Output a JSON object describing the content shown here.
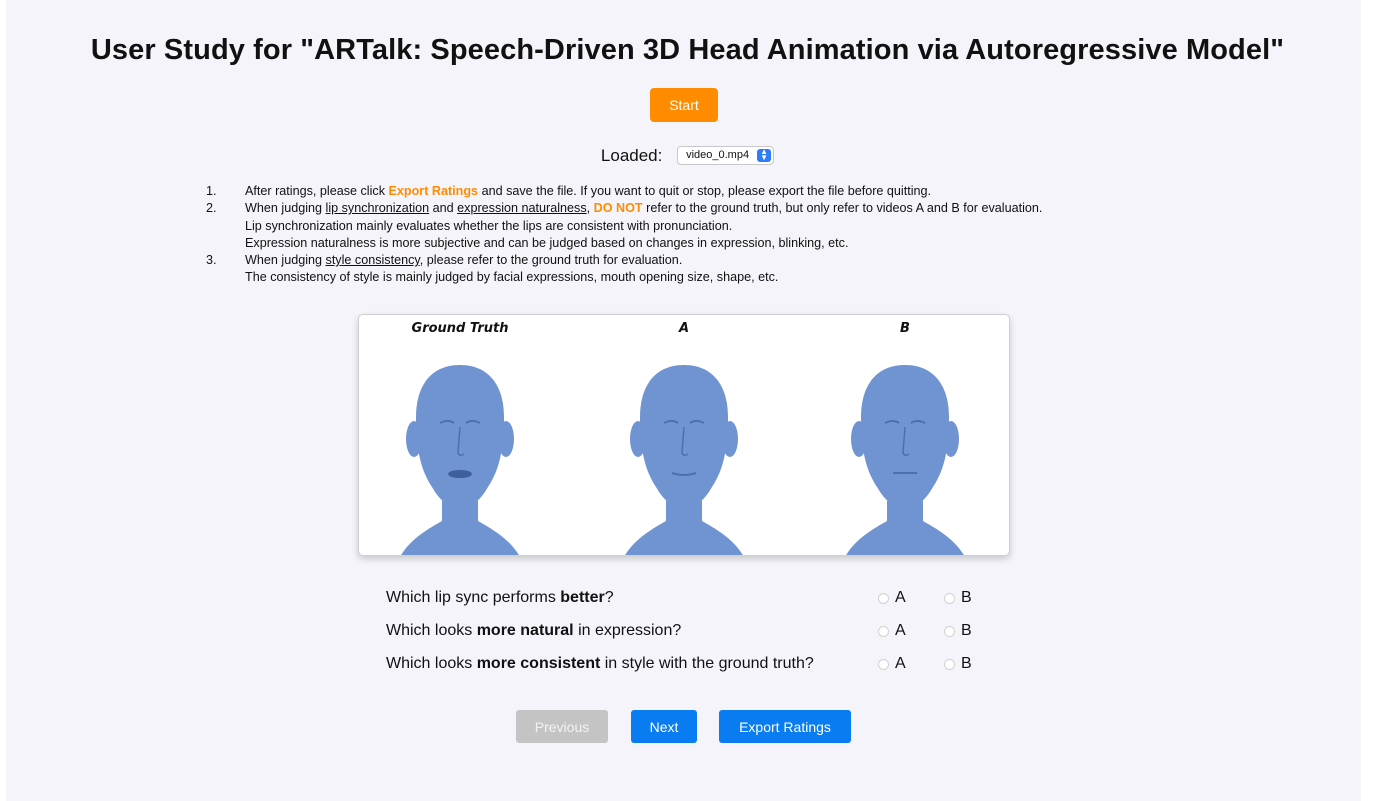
{
  "header": {
    "title": "User Study for \"ARTalk: Speech-Driven 3D Head Animation via Autoregressive Model\""
  },
  "controls": {
    "start_label": "Start",
    "loaded_label": "Loaded:",
    "video_select": "video_0.mp4"
  },
  "instructions": {
    "items": [
      {
        "num": "1.",
        "lines": [
          [
            "After ratings, please click ",
            "Export Ratings",
            " and save the file. If you want to quit or stop, please export the file before quitting."
          ]
        ]
      },
      {
        "num": "2.",
        "lines": [
          [
            "When judging ",
            "lip synchronization",
            " and ",
            "expression naturalness",
            ", ",
            "DO NOT",
            " refer to the ground truth, but only refer to videos A and B for evaluation."
          ],
          [
            "Lip synchronization mainly evaluates whether the lips are consistent with pronunciation."
          ],
          [
            "Expression naturalness is more subjective and can be judged based on changes in expression, blinking, etc."
          ]
        ]
      },
      {
        "num": "3.",
        "lines": [
          [
            "When judging ",
            "style consistency",
            ", please refer to the ground truth for evaluation."
          ],
          [
            "The consistency of style is mainly judged by facial expressions, mouth opening size, shape, etc."
          ]
        ]
      }
    ]
  },
  "video": {
    "labels": [
      "Ground Truth",
      "A",
      "B"
    ],
    "head_color": "#6f8fcf"
  },
  "questions": [
    {
      "prefix": "Which lip sync performs ",
      "bold": "better",
      "suffix": "?",
      "options": [
        "A",
        "B"
      ]
    },
    {
      "prefix": "Which looks ",
      "bold": "more natural",
      "suffix": " in expression?",
      "options": [
        "A",
        "B"
      ]
    },
    {
      "prefix": "Which looks ",
      "bold": "more consistent",
      "suffix": " in style with the ground truth?",
      "options": [
        "A",
        "B"
      ]
    }
  ],
  "navigation": {
    "previous_label": "Previous",
    "next_label": "Next",
    "export_label": "Export Ratings"
  },
  "colors": {
    "accent_orange": "#ff8c00",
    "primary_blue": "#0a7cf2",
    "disabled_gray": "#c4c4c4",
    "page_bg": "#f4f4fa"
  }
}
